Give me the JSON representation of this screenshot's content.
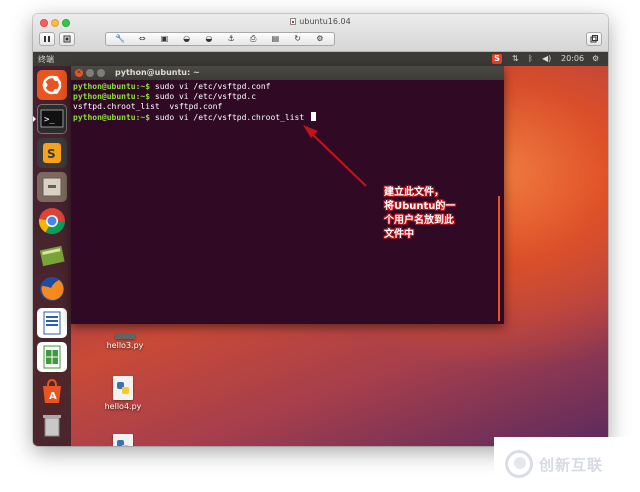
{
  "window": {
    "title": "ubuntu16.04"
  },
  "vm_toolbar": {
    "pause_icon": "pause-icon",
    "snapshot_icon": "snapshot-icon",
    "group_icons": [
      "wrench-icon",
      "arrows-icon",
      "display-icon",
      "disk-icon",
      "disk-icon",
      "usb-icon",
      "printer-icon",
      "save-icon",
      "refresh-icon",
      "gear-icon"
    ],
    "right_icon": "window-icon"
  },
  "ubuntu_topbar": {
    "app_name": "终端",
    "time": "20:06",
    "icons": [
      "sogou-icon",
      "network-icon",
      "bluetooth-icon",
      "volume-icon",
      "power-icon"
    ],
    "sogou_label": "S"
  },
  "launcher": {
    "items": [
      "ubuntu-dash-icon",
      "terminal-icon",
      "sublime-text-icon",
      "files-icon",
      "chrome-icon",
      "pycharm-icon",
      "firefox-icon",
      "writer-icon",
      "calc-icon",
      "software-center-icon",
      "trash-icon"
    ]
  },
  "terminal": {
    "title": "python@ubuntu: ~",
    "lines": [
      {
        "prompt": "python@ubuntu:~$",
        "command": " sudo vi /etc/vsftpd.conf"
      },
      {
        "prompt": "python@ubuntu:~$",
        "command": " sudo vi /etc/vsftpd.c"
      },
      {
        "prompt": "",
        "command": "vsftpd.chroot_list  vsftpd.conf"
      },
      {
        "prompt": "python@ubuntu:~$",
        "command": " sudo vi /etc/vsftpd.chroot_list "
      }
    ]
  },
  "desktop": {
    "files": [
      {
        "label": "hello3.py"
      },
      {
        "label": "hello4.py"
      }
    ]
  },
  "annotation": {
    "lines": [
      "建立此文件，",
      "将Ubuntu的一",
      "个用户名放到此",
      "文件中"
    ]
  },
  "watermark": {
    "text": "创新互联"
  },
  "colors": {
    "terminal_bg": "#300a24",
    "prompt_green": "#8ae234",
    "annotation_red": "#c0141b",
    "ubuntu_orange": "#e95420"
  }
}
